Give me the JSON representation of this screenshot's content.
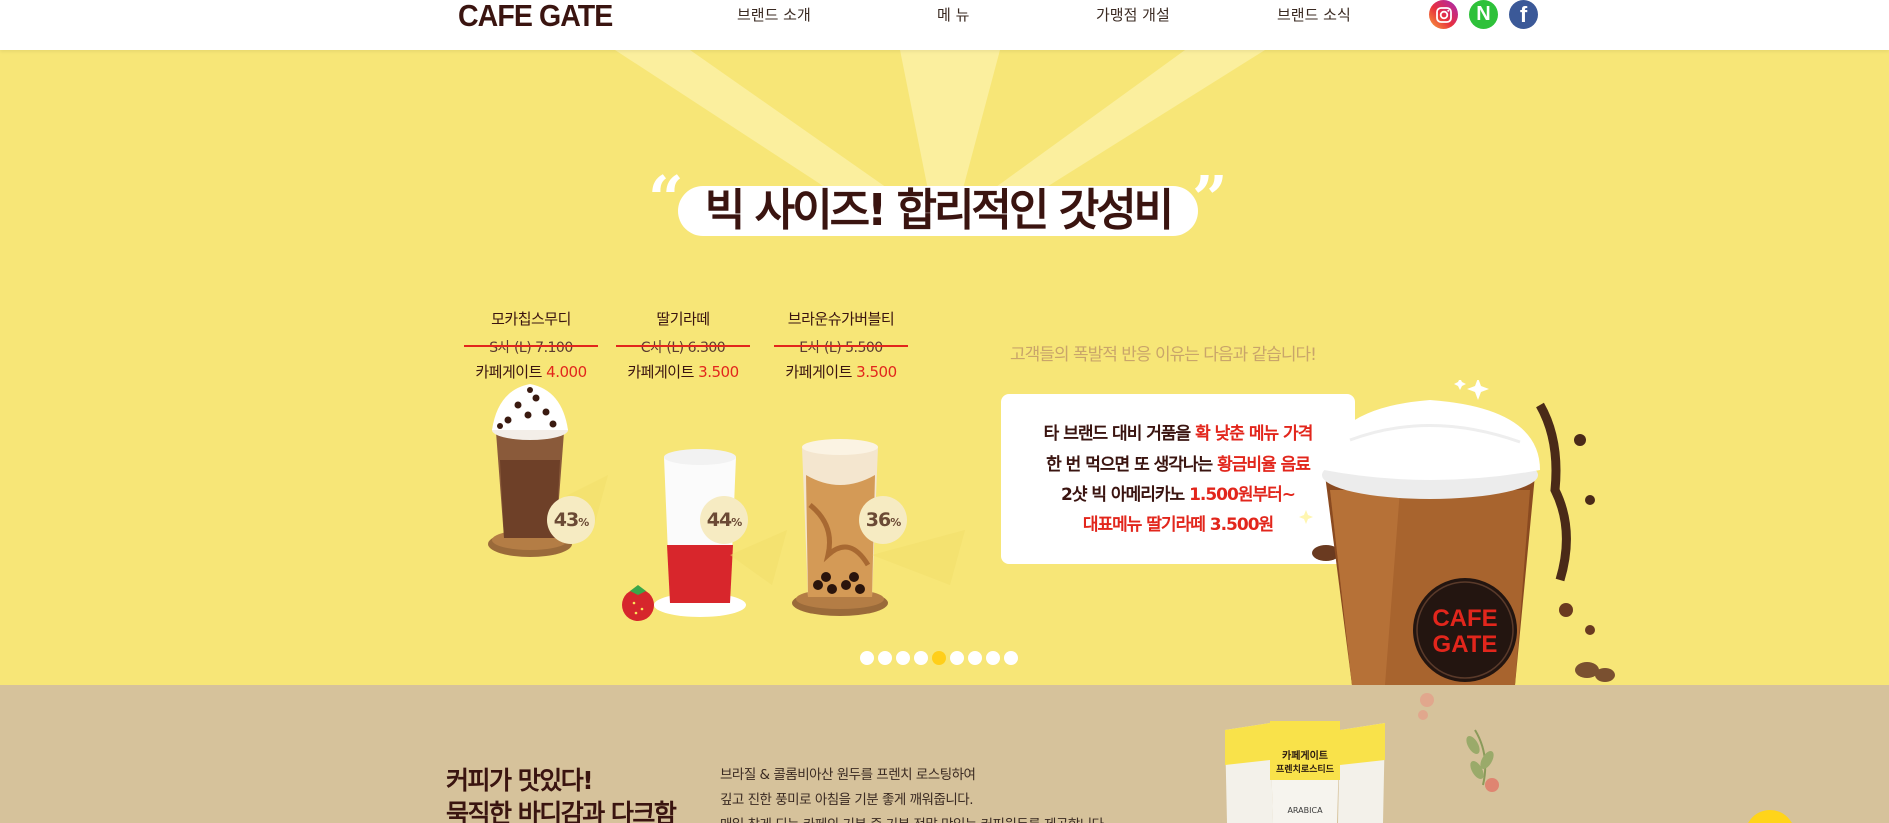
{
  "header": {
    "logo": "CAFE GATE",
    "nav": [
      "브랜드 소개",
      "메 뉴",
      "가맹점 개설",
      "브랜드 소식"
    ],
    "social": [
      {
        "name": "instagram-icon",
        "glyph": ""
      },
      {
        "name": "naver-icon",
        "glyph": "N"
      },
      {
        "name": "facebook-icon",
        "glyph": "f"
      }
    ]
  },
  "hero": {
    "quote_open": "“",
    "quote_close": "”",
    "headline": "빅 사이즈! 합리적인 갓성비",
    "products": [
      {
        "name": "모카칩스무디",
        "old_label": "S사 (L)",
        "old_price": "7.100",
        "new_label": "카페게이트",
        "new_price": "4.000",
        "discount": "43",
        "unit": "%"
      },
      {
        "name": "딸기라떼",
        "old_label": "C사 (L)",
        "old_price": "6.300",
        "new_label": "카페게이트",
        "new_price": "3.500",
        "discount": "44",
        "unit": "%"
      },
      {
        "name": "브라운슈가버블티",
        "old_label": "E사 (L)",
        "old_price": "5.500",
        "new_label": "카페게이트",
        "new_price": "3.500",
        "discount": "36",
        "unit": "%"
      }
    ],
    "tagline": "고객들의 폭발적 반응 이유는 다음과 같습니다!",
    "card": [
      {
        "text": "타 브랜드 대비 거품을 ",
        "highlight": "확 낮춘 메뉴 가격"
      },
      {
        "text": "한 번 먹으면 또 생각나는 ",
        "highlight": "황금비율 음료"
      },
      {
        "text": "2샷 빅 아메리카노 ",
        "highlight": "1.500원부터~"
      },
      {
        "text": "",
        "highlight": "대표메뉴 딸기라떼 3.500원"
      }
    ],
    "cup_logo": [
      "CAFE",
      "GATE"
    ],
    "slider_dots": 9,
    "active_dot": 4
  },
  "beans": {
    "title_lines": [
      "커피가 맛있다!",
      "묵직한 바디감과 다크함"
    ],
    "desc_lines": [
      "브라질 & 콜롬비아산 원두를 프렌치 로스팅하여",
      "깊고 진한 풍미로 아침을 기분 좋게 깨워줍니다.",
      "매일 찾게 되는 카페의 기본 중 기본 정말 맛있는 커피원두를 제공합니다."
    ],
    "bag_labels": [
      "카페게이트",
      "프렌치로스티드",
      "ARABICA"
    ]
  },
  "colors": {
    "hero_bg": "#f7e677",
    "beans_bg": "#d6c29b",
    "brand_brown": "#3a1410",
    "accent_red": "#e2261c",
    "dot_active": "#ffcf1a"
  }
}
